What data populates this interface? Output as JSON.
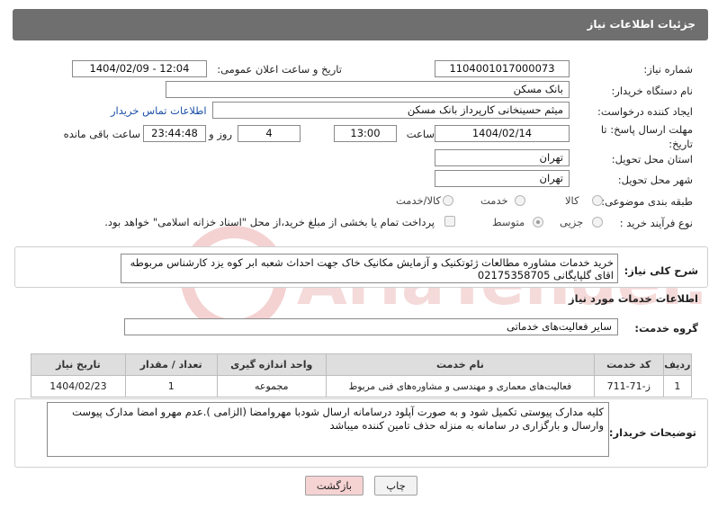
{
  "header": {
    "title": "جزئیات اطلاعات نیاز"
  },
  "form": {
    "need_number_label": "شماره نیاز:",
    "need_number": "1104001017000073",
    "announce_label": "تاریخ و ساعت اعلان عمومی:",
    "announce_value": "1404/02/09 - 12:04",
    "buyer_org_label": "نام دستگاه خریدار:",
    "buyer_org": "بانک مسکن",
    "creator_label": "ایجاد کننده درخواست:",
    "creator": "میثم حسینخانی کارپرداز بانک مسکن",
    "contact_link": "اطلاعات تماس خریدار",
    "deadline_label": "مهلت ارسال پاسخ: تا تاریخ:",
    "deadline_date": "1404/02/14",
    "time_label": "ساعت",
    "deadline_time": "13:00",
    "days_value": "4",
    "days_label": "روز و",
    "remaining_value": "23:44:48",
    "remaining_label": "ساعت باقی مانده",
    "province_label": "استان محل تحویل:",
    "province": "تهران",
    "city_label": "شهر محل تحویل:",
    "city": "تهران",
    "category_label": "طبقه بندی موضوعی:",
    "category_options": [
      "کالا",
      "خدمت",
      "کالا/خدمت"
    ],
    "process_label": "نوع فرآیند خرید :",
    "process_options": [
      "جزیی",
      "متوسط"
    ],
    "payment_note": "پرداخت تمام یا بخشی از مبلغ خرید،از محل \"اسناد خزانه اسلامی\" خواهد بود."
  },
  "summary": {
    "label": "شرح کلی نیاز:",
    "text": "خرید خدمات مشاوره مطالعات ژئوتکنیک و آزمایش مکانیک خاک جهت احداث شعبه ابر کوه یزد کارشناس مربوطه اقای گلپایگانی 02175358705"
  },
  "services": {
    "title": "اطلاعات خدمات مورد نیاز",
    "group_label": "گروه خدمت:",
    "group_value": "سایر فعالیت‌های خدماتی",
    "columns": [
      "ردیف",
      "کد خدمت",
      "نام خدمت",
      "واحد اندازه گیری",
      "تعداد / مقدار",
      "تاریخ نیاز"
    ],
    "rows": [
      [
        "1",
        "ز-71-711",
        "فعالیت‌های معماری و مهندسی و مشاوره‌های فنی مربوط",
        "مجموعه",
        "1",
        "1404/02/23"
      ]
    ]
  },
  "buyer_notes": {
    "label": "توضیحات خریدار:",
    "text": "کلیه مدارک پیوستی تکمیل شود و به صورت آپلود درسامانه ارسال شودبا مهروامضا (الزامی ).عدم مهرو امضا مدارک پیوست وارسال و بارگزاری در سامانه به منزله حذف تامین کننده میباشد"
  },
  "buttons": {
    "print": "چاپ",
    "back": "بازگشت"
  },
  "watermark": "AriaTender.net",
  "colors": {
    "header_bg": "#6f6f6f",
    "link": "#1a4fa8",
    "back_btn": "#f6d3d3",
    "print_btn": "#f2f2f2",
    "watermark": "#f2c7c7"
  }
}
